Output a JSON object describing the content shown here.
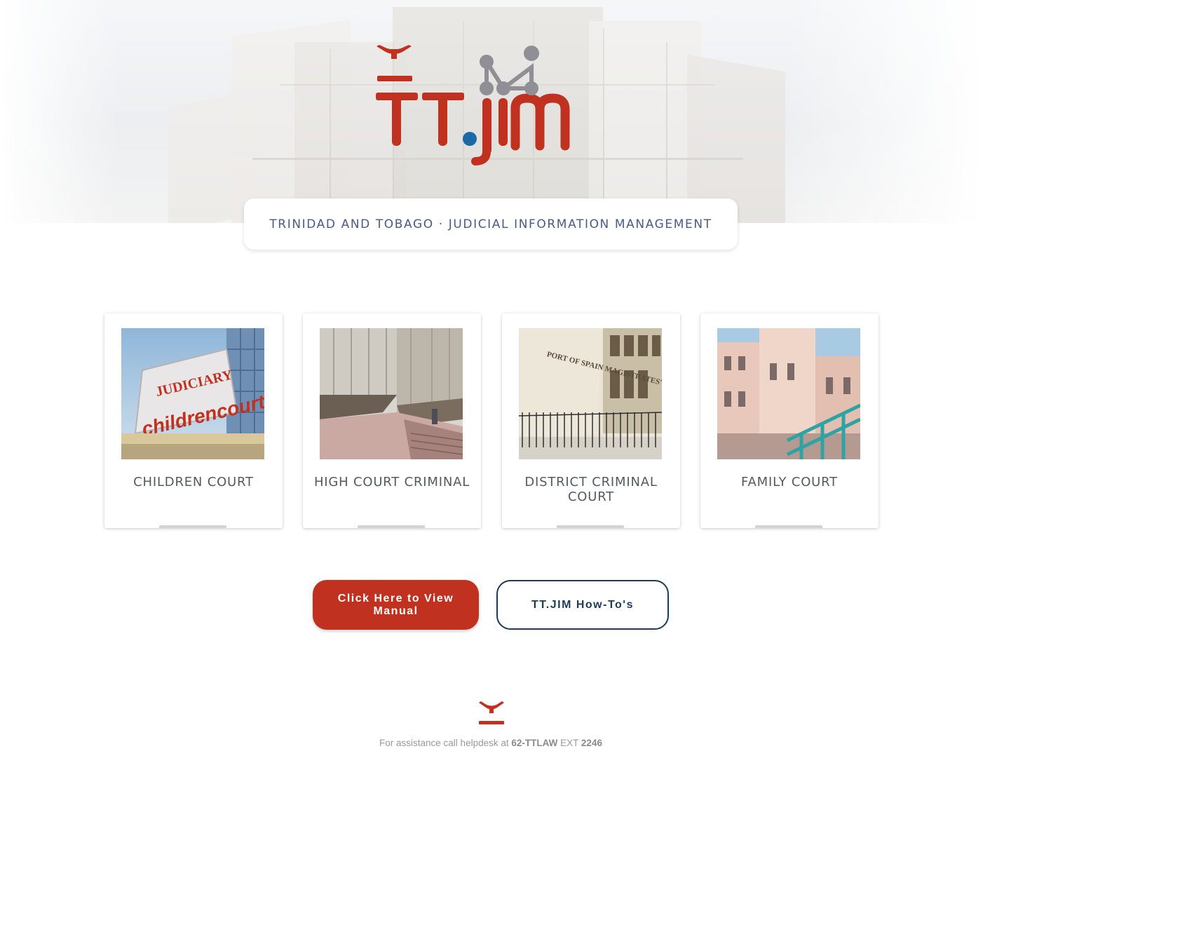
{
  "header": {
    "logo_text": "TT.jim",
    "tagline": "TRINIDAD AND TOBAGO · JUDICIAL INFORMATION MANAGEMENT"
  },
  "courts": [
    {
      "label": "CHILDREN COURT",
      "photo_sign_top": "JUDICIARY",
      "photo_sign_bottom": "childrencourt"
    },
    {
      "label": "HIGH COURT CRIMINAL"
    },
    {
      "label": "DISTRICT CRIMINAL COURT",
      "photo_sign": "PORT OF SPAIN MAGISTRATES' COURT"
    },
    {
      "label": "FAMILY COURT"
    }
  ],
  "buttons": {
    "manual_label": "Click Here to View Manual",
    "howto_label": "TT.JIM How-To's"
  },
  "footer": {
    "text_prefix": "For assistance call helpdesk at",
    "phone": "62-TTLAW",
    "ext_label": "EXT",
    "ext_number": "2246"
  },
  "colors": {
    "brand_red": "#c0321f",
    "brand_blue": "#1b6aa8",
    "network_gray": "#8f8f95",
    "navy": "#1d3a57",
    "tagline_text": "#4a5a86"
  },
  "icons": {
    "logo_mark": "judiciary-bird-emblem",
    "logo_network": "network-nodes-icon"
  }
}
